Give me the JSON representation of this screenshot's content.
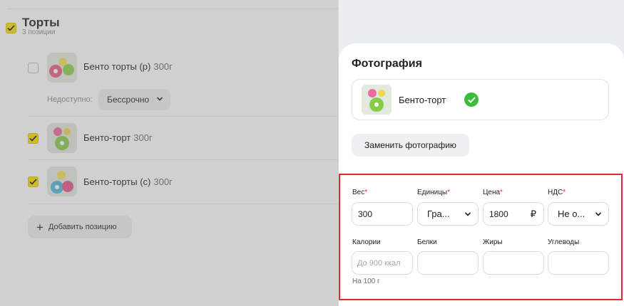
{
  "category": {
    "title": "Торты",
    "subtitle": "3 позиции",
    "checked": true
  },
  "items": [
    {
      "name": "Бенто торты (р)",
      "weight": "300г",
      "checked": false
    },
    {
      "name": "Бенто-торт",
      "weight": "300г",
      "checked": true
    },
    {
      "name": "Бенто-торты (с)",
      "weight": "300г",
      "checked": true
    }
  ],
  "unavailable": {
    "label": "Недоступно:",
    "value": "Бессрочно"
  },
  "add_button": "Добавить позицию",
  "panel": {
    "photo": {
      "title": "Фотография",
      "file_name": "Бенто-торт",
      "status": "ok-icon",
      "replace_button": "Заменить фотографию"
    },
    "form": {
      "weight": {
        "label": "Вес",
        "value": "300"
      },
      "units": {
        "label": "Единицы",
        "value": "Гра..."
      },
      "price": {
        "label": "Цена",
        "value": "1800",
        "currency": "₽"
      },
      "vat": {
        "label": "НДС",
        "value": "Не о..."
      },
      "calories": {
        "label": "Калории",
        "placeholder": "До 900 ккал",
        "note": "На 100 г"
      },
      "protein": {
        "label": "Белки",
        "value": ""
      },
      "fat": {
        "label": "Жиры",
        "value": ""
      },
      "carbs": {
        "label": "Углеводы",
        "value": ""
      },
      "required_mark": "*"
    }
  },
  "colors": {
    "accent_yellow": "#fce000",
    "success_green": "#3bbd3b",
    "required_red": "#e2272d",
    "highlight_border": "#e2272d"
  }
}
